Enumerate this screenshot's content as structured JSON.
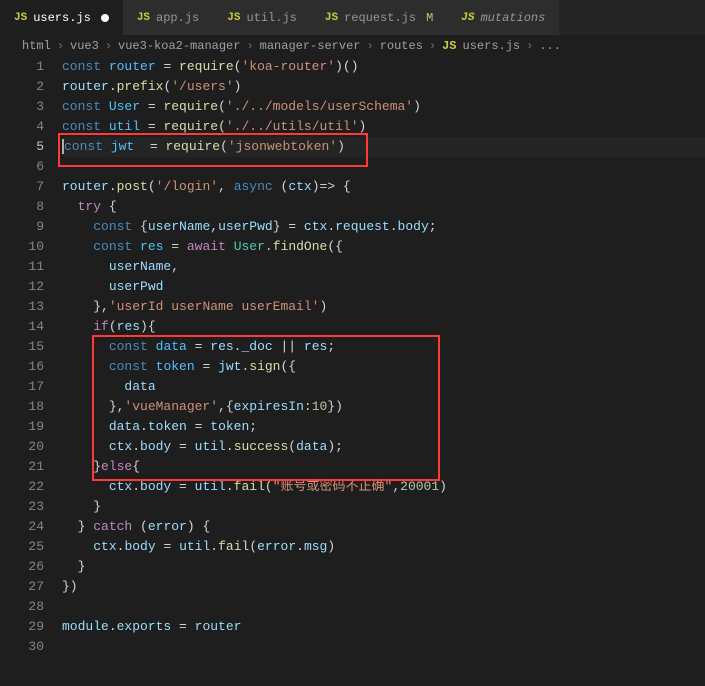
{
  "tabs": [
    {
      "icon": "JS",
      "name": "users.js",
      "active": true,
      "dirty": true,
      "mod": ""
    },
    {
      "icon": "JS",
      "name": "app.js",
      "active": false,
      "dirty": false,
      "mod": ""
    },
    {
      "icon": "JS",
      "name": "util.js",
      "active": false,
      "dirty": false,
      "mod": ""
    },
    {
      "icon": "JS",
      "name": "request.js",
      "active": false,
      "dirty": false,
      "mod": "M"
    },
    {
      "icon": "JS",
      "name": "mutations",
      "active": false,
      "dirty": false,
      "mod": "",
      "italic": true
    }
  ],
  "breadcrumbs": [
    "html",
    "vue3",
    "vue3-koa2-manager",
    "manager-server",
    "routes",
    "users.js",
    "..."
  ],
  "breadcrumbs_file_icon": "JS",
  "lineCount": 30,
  "activeLine": 5,
  "code": {
    "l1": {
      "const": "const",
      "router": "router",
      "eq": " = ",
      "require": "require",
      "p1": "(",
      "s": "'koa-router'",
      "p2": ")()"
    },
    "l2": {
      "router": "router",
      "dot": ".",
      "prefix": "prefix",
      "p1": "(",
      "s": "'/users'",
      "p2": ")"
    },
    "l3": {
      "const": "const",
      "user": "User",
      "eq": " = ",
      "require": "require",
      "p1": "(",
      "s": "'./../models/userSchema'",
      "p2": ")"
    },
    "l4": {
      "const": "const",
      "util": "util",
      "eq": " = ",
      "require": "require",
      "p1": "(",
      "s": "'./../utils/util'",
      "p2": ")"
    },
    "l5": {
      "const": "const",
      "jwt": "jwt",
      "eq": "  = ",
      "require": "require",
      "p1": "(",
      "s": "'jsonwebtoken'",
      "p2": ")"
    },
    "l7": {
      "router": "router",
      "dot": ".",
      "post": "post",
      "p1": "(",
      "s": "'/login'",
      "c": ", ",
      "async": "async",
      "sp": " (",
      "ctx": "ctx",
      "arr": ")=> {"
    },
    "l8": {
      "try": "try",
      "b": " {"
    },
    "l9": {
      "const": "const",
      "sp": " {",
      "u1": "userName",
      "c1": ",",
      "u2": "userPwd",
      "p": "} = ",
      "ctx": "ctx",
      "d1": ".",
      "req": "request",
      "d2": ".",
      "body": "body",
      "semi": ";"
    },
    "l10": {
      "const": "const",
      "res": "res",
      "eq": " = ",
      "await": "await",
      "sp": " ",
      "user": "User",
      "d": ".",
      "fo": "findOne",
      "p": "({"
    },
    "l11": {
      "u": "userName",
      "c": ","
    },
    "l12": {
      "u": "userPwd"
    },
    "l13": {
      "p1": "},",
      "s": "'userId userName userEmail'",
      "p2": ")"
    },
    "l14": {
      "if": "if",
      "p1": "(",
      "res": "res",
      "p2": "){"
    },
    "l15": {
      "const": "const",
      "data": "data",
      "eq": " = ",
      "res": "res",
      "d": ".",
      "doc": "_doc",
      "or": " || ",
      "res2": "res",
      "semi": ";"
    },
    "l16": {
      "const": "const",
      "token": "token",
      "eq": " = ",
      "jwt": "jwt",
      "d": ".",
      "sign": "sign",
      "p": "({"
    },
    "l17": {
      "data": "data"
    },
    "l18": {
      "p1": "},",
      "s": "'vueManager'",
      "c": ",{",
      "exp": "expiresIn",
      "col": ":",
      "n": "10",
      "p2": "})"
    },
    "l19": {
      "data": "data",
      "d": ".",
      "token": "token",
      "eq": " = ",
      "token2": "token",
      "semi": ";"
    },
    "l20": {
      "ctx": "ctx",
      "d": ".",
      "body": "body",
      "eq": " = ",
      "util": "util",
      "d2": ".",
      "succ": "success",
      "p1": "(",
      "data": "data",
      "p2": ");"
    },
    "l21": {
      "p1": "}",
      "else": "else",
      "p2": "{"
    },
    "l22": {
      "ctx": "ctx",
      "d": ".",
      "body": "body",
      "eq": " = ",
      "util": "util",
      "d2": ".",
      "fail": "fail",
      "p1": "(",
      "s": "\"账号或密码不正确\"",
      "c": ",",
      "n": "20001",
      "p2": ")"
    },
    "l23": {
      "p": "}"
    },
    "l24": {
      "p1": "} ",
      "catch": "catch",
      "sp": " (",
      "err": "error",
      "p2": ") {"
    },
    "l25": {
      "ctx": "ctx",
      "d": ".",
      "body": "body",
      "eq": " = ",
      "util": "util",
      "d2": ".",
      "fail": "fail",
      "p1": "(",
      "err": "error",
      "d3": ".",
      "msg": "msg",
      "p2": ")"
    },
    "l26": {
      "p": "}"
    },
    "l27": {
      "p": "})"
    },
    "l29": {
      "mod": "module",
      "d": ".",
      "exp": "exports",
      "eq": " = ",
      "router": "router"
    }
  }
}
